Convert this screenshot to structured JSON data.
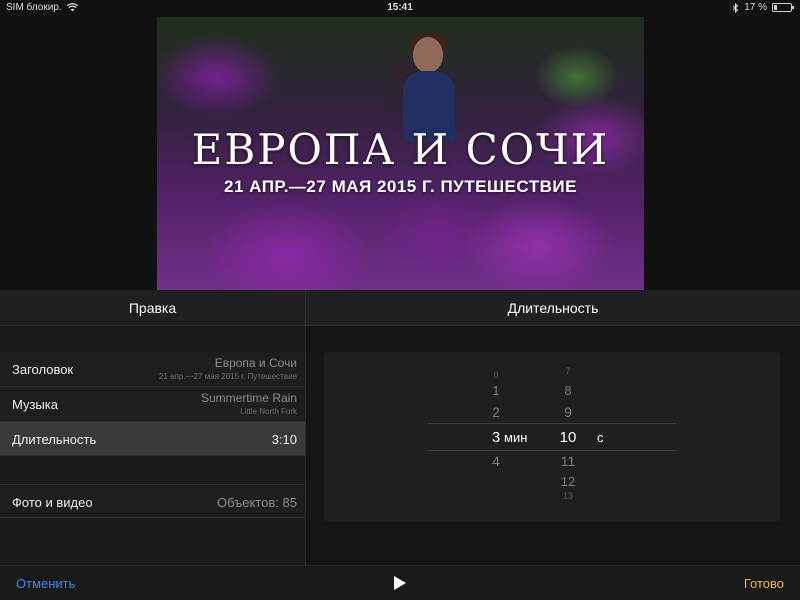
{
  "status_bar": {
    "carrier": "SIM блокир.",
    "time": "15:41",
    "battery": "17 %"
  },
  "preview": {
    "title": "ЕВРОПА И СОЧИ",
    "subtitle": "21 АПР.—27 МАЯ 2015 Г. ПУТЕШЕСТВИЕ"
  },
  "edit_panel": {
    "header": "Правка",
    "rows": [
      {
        "label": "Заголовок",
        "value": "Европа и Сочи",
        "sub": "21 апр.—27 мая 2015 г. Путешествие"
      },
      {
        "label": "Музыка",
        "value": "Summertime Rain",
        "sub": "Little North Fork"
      },
      {
        "label": "Длительность",
        "value": "3:10"
      },
      {
        "label": "Фото и видео",
        "value": "Объектов: 85"
      }
    ]
  },
  "duration_panel": {
    "header": "Длительность",
    "minutes": {
      "above": [
        "0",
        "1",
        "2"
      ],
      "selected": "3",
      "below": [
        "4"
      ],
      "unit": "мин"
    },
    "seconds": {
      "above": [
        "7",
        "8",
        "9"
      ],
      "selected": "10",
      "below": [
        "11",
        "12",
        "13"
      ],
      "unit": "с"
    }
  },
  "toolbar": {
    "cancel": "Отменить",
    "done": "Готово"
  },
  "colors": {
    "cancel_blue": "#2f8cf0",
    "done_yellow": "#f5b82e"
  }
}
